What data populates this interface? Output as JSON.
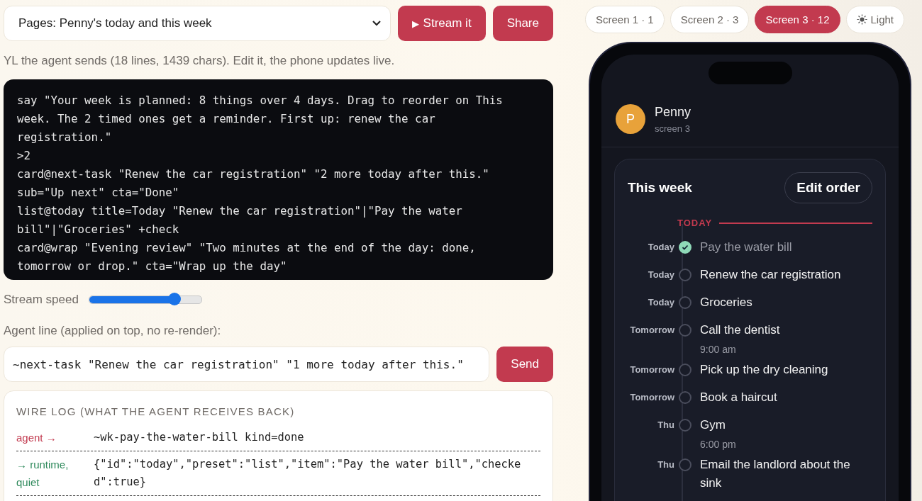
{
  "page_select": {
    "value": "Pages: Penny's today and this week"
  },
  "actions": [
    {
      "kind": "stream",
      "icon": "▶",
      "label": "Stream it"
    },
    {
      "kind": "share",
      "label": "Share"
    }
  ],
  "description": "YL the agent sends (18 lines, 1439 chars). Edit it, the phone updates live.",
  "editor": {
    "lines": [
      "say \"Your week is planned: 8 things over 4 days. Drag to reorder on This week. The 2 timed ones get a reminder. First up: renew the car registration.\"",
      ">2",
      "card@next-task \"Renew the car registration\" \"2 more today after this.\" sub=\"Up next\" cta=\"Done\"",
      "list@today title=Today \"Renew the car registration\"|\"Pay the water bill\"|\"Groceries\" +check",
      "card@wrap \"Evening review\" \"Two minutes at the end of the day: done, tomorrow or drop.\" cta=\"Wrap up the day\""
    ]
  },
  "stream_speed": {
    "label": "Stream speed",
    "level": 0.76
  },
  "agent_line": {
    "label": "Agent line (applied on top, no re-render):",
    "value": "~next-task \"Renew the car registration\" \"1 more today after this.\"",
    "button": "Send"
  },
  "wire_log": {
    "title": "WIRE LOG (WHAT THE AGENT RECEIVES BACK)",
    "entries": [
      {
        "kind": "outgoing",
        "direction": "agent →",
        "text": "~wk-pay-the-water-bill kind=done"
      },
      {
        "kind": "incoming",
        "direction": "→ runtime, quiet",
        "text": "{\"id\":\"today\",\"preset\":\"list\",\"item\":\"Pay the water bill\",\"checked\":true}"
      }
    ]
  },
  "screen_tabs": [
    {
      "label": "Screen 1 · 1",
      "selected": false
    },
    {
      "label": "Screen 2 · 3",
      "selected": false
    },
    {
      "label": "Screen 3 · 12",
      "selected": true
    }
  ],
  "theme_button": {
    "label": "Light"
  },
  "phone": {
    "user": {
      "initial": "P",
      "name": "Penny",
      "subtitle": "screen 3"
    },
    "card": {
      "title": "This week",
      "button": "Edit order",
      "section": "TODAY",
      "items": [
        {
          "day": "Today",
          "title": "Pay the water bill",
          "checked": true
        },
        {
          "day": "Today",
          "title": "Renew the car registration",
          "checked": false
        },
        {
          "day": "Today",
          "title": "Groceries",
          "checked": false
        },
        {
          "day": "Tomorrow",
          "title": "Call the dentist",
          "time": "9:00 am",
          "checked": false
        },
        {
          "day": "Tomorrow",
          "title": "Pick up the dry cleaning",
          "checked": false
        },
        {
          "day": "Tomorrow",
          "title": "Book a haircut",
          "checked": false
        },
        {
          "day": "Thu",
          "title": "Gym",
          "time": "6:00 pm",
          "checked": false
        },
        {
          "day": "Thu",
          "title": "Email the landlord about the sink",
          "checked": false
        }
      ]
    }
  }
}
